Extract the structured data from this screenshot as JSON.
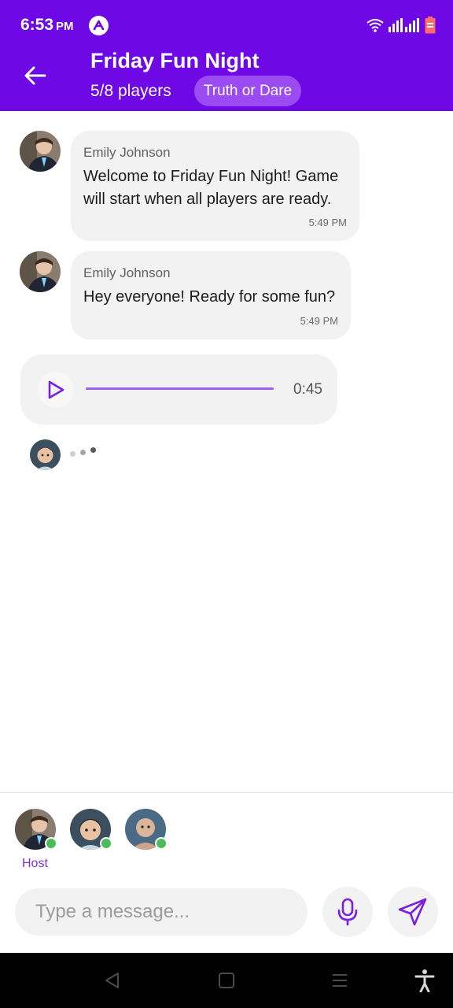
{
  "status_bar": {
    "time": "6:53",
    "ampm": "PM"
  },
  "header": {
    "title": "Friday Fun Night",
    "players": "5/8 players",
    "game_type": "Truth or Dare"
  },
  "messages": [
    {
      "sender": "Emily Johnson",
      "text": "Welcome to Friday Fun Night! Game will start when all players are ready.",
      "time": "5:49 PM"
    },
    {
      "sender": "Emily Johnson",
      "text": "Hey everyone! Ready for some fun?",
      "time": "5:49 PM"
    }
  ],
  "voice_message": {
    "duration": "0:45"
  },
  "players_bar": {
    "host_label": "Host"
  },
  "composer": {
    "placeholder": "Type a message..."
  },
  "colors": {
    "brand": "#6e08e4",
    "chip": "#9a4cf2",
    "bubble": "#f2f2f2",
    "online": "#4cbb5a"
  },
  "icons": {
    "back": "arrow-left-icon",
    "play": "play-icon",
    "mic": "microphone-icon",
    "send": "send-icon"
  }
}
